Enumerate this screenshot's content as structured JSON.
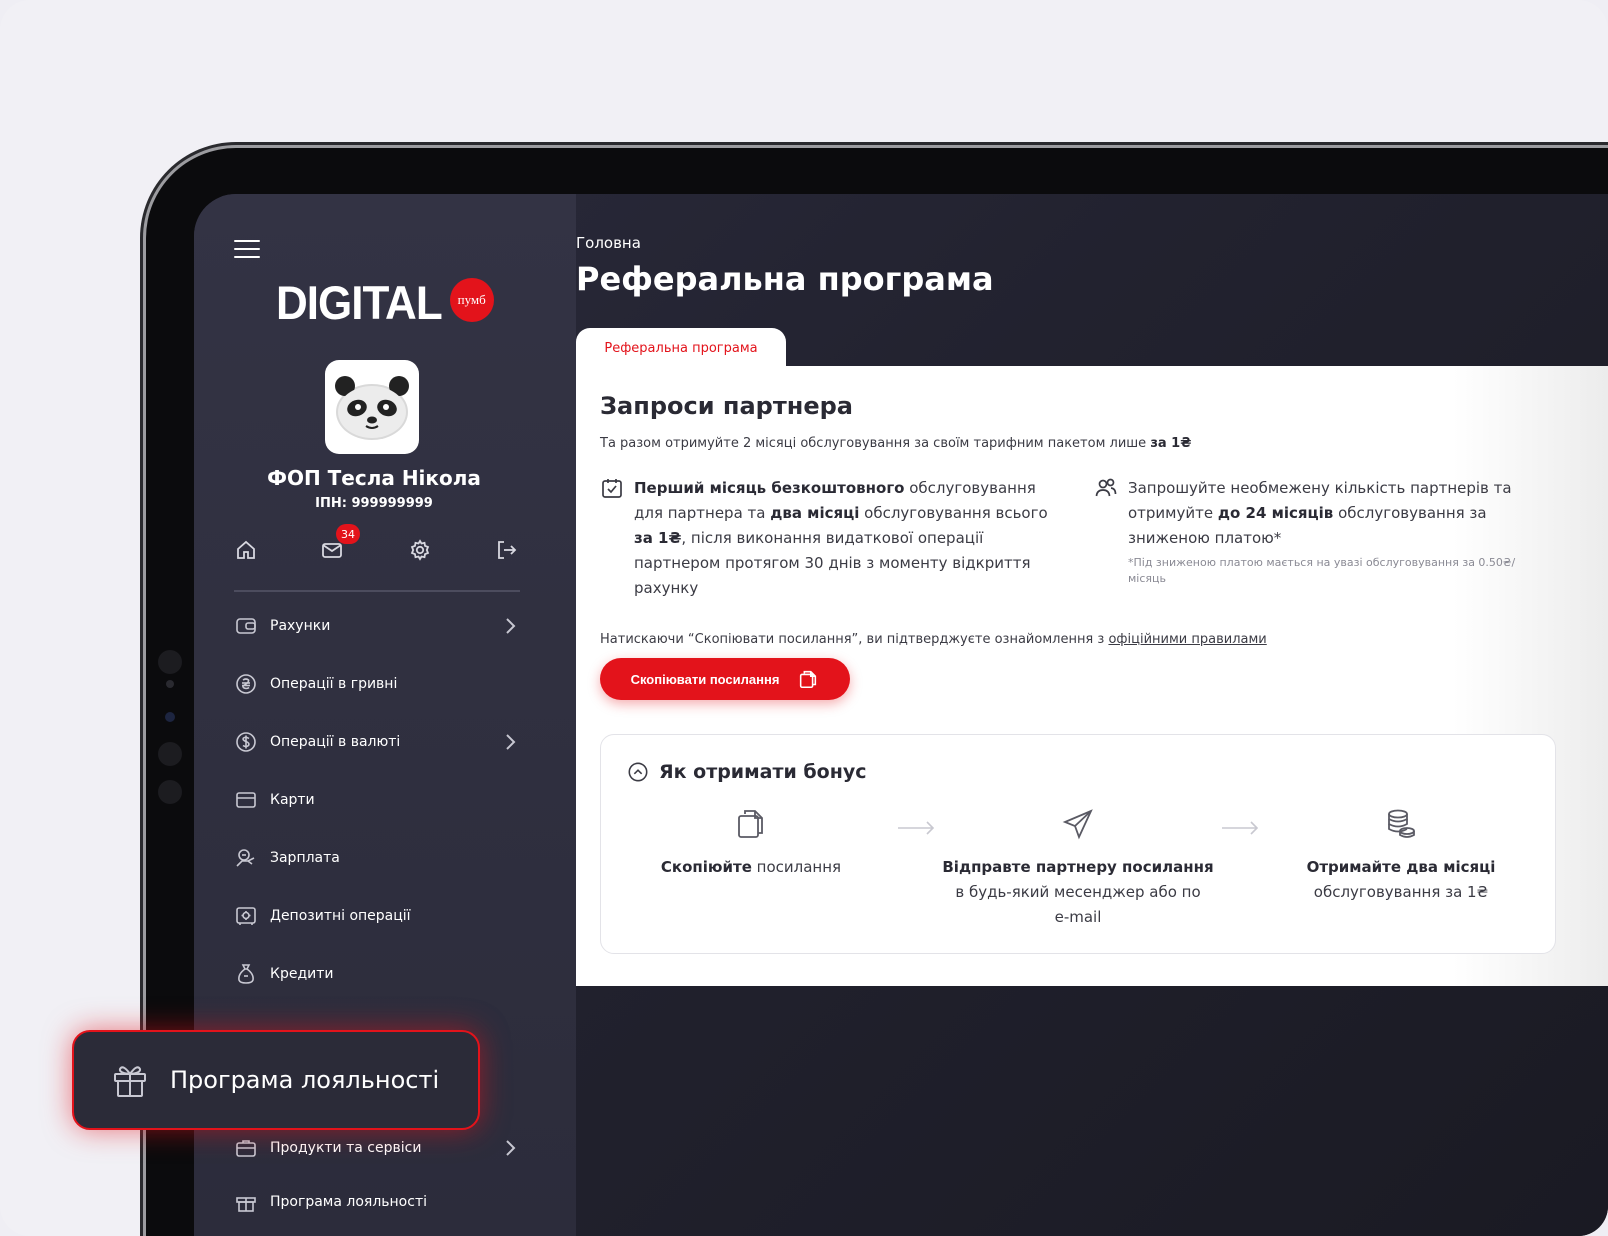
{
  "sidebar": {
    "logo": {
      "text": "DIGITAL",
      "badge": "пумб"
    },
    "user": {
      "name": "ФОП Тесла Нікола",
      "inn": "ІПН: 999999999"
    },
    "quick_icons": {
      "messages_count": "34"
    },
    "items": [
      {
        "label": "Рахунки",
        "icon": "wallet-icon",
        "has_submenu": true
      },
      {
        "label": "Операції в гривні",
        "icon": "hryvnia-icon",
        "has_submenu": false
      },
      {
        "label": "Операції в валюті",
        "icon": "dollar-icon",
        "has_submenu": true
      },
      {
        "label": "Карти",
        "icon": "card-icon",
        "has_submenu": false
      },
      {
        "label": "Зарплата",
        "icon": "salary-icon",
        "has_submenu": false
      },
      {
        "label": "Депозитні операції",
        "icon": "safe-icon",
        "has_submenu": false
      },
      {
        "label": "Кредити",
        "icon": "money-bag-icon",
        "has_submenu": false
      },
      {
        "label": "Продукти та сервіси",
        "icon": "briefcase-icon",
        "has_submenu": true
      },
      {
        "label": "Програма лояльності",
        "icon": "gift-icon",
        "has_submenu": false
      }
    ],
    "loyalty_popup": {
      "label": "Програма лояльності",
      "icon": "gift-icon"
    }
  },
  "main": {
    "breadcrumb": "Головна",
    "title": "Реферальна програма",
    "tab": "Реферальна програма",
    "card": {
      "title": "Запроси партнера",
      "subtitle_prefix": "Та разом отримуйте 2 місяці обслуговування за своїм тарифним пакетом лише",
      "subtitle_bold": "за 1₴",
      "benefit_left": {
        "p1_bold": "Перший місяць безкоштовного",
        "p2": " обслуговування для партнера та ",
        "p3_bold": "два місяці",
        "p4": " обслуговування всього ",
        "p5_bold": "за 1₴",
        "p6": ", після виконання видаткової операції партнером протягом 30 днів з моменту відкриття рахунку"
      },
      "benefit_right": {
        "p1": "Запрошуйте необмежену кількість партнерів та отримуйте ",
        "p2_bold": "до 24 місяців",
        "p3": " обслуговування за зниженою платою*",
        "footnote": "*Під зниженою платою мається на увазі обслуговування за 0.50₴/місяць"
      },
      "consent_text": "Натискаючи “Скопіювати посилання”, ви підтверджуєте ознайомлення з",
      "consent_link": "офіційними правилами",
      "copy_button": "Скопіювати посилання",
      "bonus": {
        "title": "Як отримати бонус",
        "steps": [
          {
            "bold": "Скопіюйте",
            "text": " посилання",
            "text2": ""
          },
          {
            "bold": "Відправте партнеру посилання",
            "text": "в будь-який месенджер або по",
            "text2": "e-mail"
          },
          {
            "bold": "Отримайте два місяці",
            "text": "обслуговування за 1₴",
            "text2": ""
          }
        ]
      }
    }
  },
  "colors": {
    "accent": "#e3131b",
    "sidebar_bg": "#2f2f3e",
    "text_dark": "#2a2a34"
  }
}
